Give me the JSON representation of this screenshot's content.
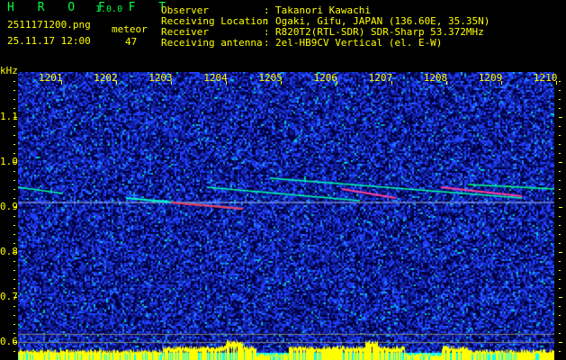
{
  "header": {
    "app_title": "HROFFT",
    "version": "1.0.0",
    "filename": "2511171200.png",
    "datetime": "25.11.17 12:00",
    "meteor_label": "meteor",
    "meteor_count": "47"
  },
  "info": [
    {
      "label": "Observer",
      "value": "Takanori Kawachi"
    },
    {
      "label": "Receiving Location",
      "value": "Ogaki, Gifu, JAPAN (136.60E, 35.35N)"
    },
    {
      "label": "Receiver",
      "value": "R820T2(RTL-SDR) SDR-Sharp 53.372MHz"
    },
    {
      "label": "Receiving antenna",
      "value": "2el-HB9CV Vertical (el. E-W)"
    }
  ],
  "spectrogram": {
    "y_unit": "kHz",
    "x_ticks": [
      "1201",
      "1202",
      "1203",
      "1204",
      "1205",
      "1206",
      "1207",
      "1208",
      "1209",
      "1210"
    ],
    "y_ticks": [
      "1.1",
      "1.0",
      "0.9",
      "0.8",
      "0.7",
      "0.6"
    ],
    "colors": {
      "background": "#0a0a60",
      "noise": "#2040ff",
      "signal": "#00ffff",
      "strong": "#ff3030",
      "level_bar": "#ffff00",
      "level_base": "#00ffff",
      "text": "#ffff00"
    }
  }
}
